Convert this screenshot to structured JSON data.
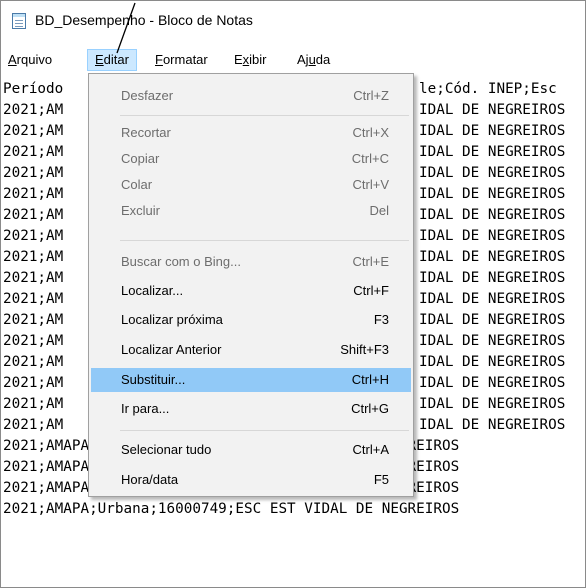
{
  "window": {
    "title": "BD_Desempenho - Bloco de Notas"
  },
  "menubar": {
    "items": [
      {
        "label": "Arquivo",
        "underline": "A",
        "rest": "rquivo"
      },
      {
        "label": "Editar",
        "underline": "E",
        "rest": "ditar"
      },
      {
        "label": "Formatar",
        "underline": "F",
        "rest": "ormatar"
      },
      {
        "label": "Exibir",
        "pre": "E",
        "underline": "x",
        "rest": "ibir"
      },
      {
        "label": "Ajuda",
        "pre": "Aj",
        "underline": "u",
        "rest": "da"
      }
    ],
    "active": "Editar"
  },
  "editor": {
    "lines": [
      "Período",
      "2021;AM",
      "2021;AM",
      "2021;AM",
      "2021;AM",
      "2021;AM",
      "2021;AM",
      "2021;AM",
      "2021;AM",
      "2021;AM",
      "2021;AM",
      "2021;AM",
      "2021;AM",
      "2021;AM",
      "2021;AM",
      "2021;AM",
      "2021;AM",
      "2021;AMAPA;Urbana;16000749;ESC EST VIDAL DE NEGREIROS",
      "2021;AMAPA;Urbana;16000749;ESC EST VIDAL DE NEGREIROS",
      "2021;AMAPA;Urbana;16000749;ESC EST VIDAL DE NEGREIROS",
      "2021;AMAPA;Urbana;16000749;ESC EST VIDAL DE NEGREIROS"
    ],
    "right_fragments": [
      "le;Cód. INEP;Esc",
      "IDAL DE NEGREIROS",
      "IDAL DE NEGREIROS",
      "IDAL DE NEGREIROS",
      "IDAL DE NEGREIROS",
      "IDAL DE NEGREIROS",
      "IDAL DE NEGREIROS",
      "IDAL DE NEGREIROS",
      "IDAL DE NEGREIROS",
      "IDAL DE NEGREIROS",
      "IDAL DE NEGREIROS",
      "IDAL DE NEGREIROS",
      "IDAL DE NEGREIROS",
      "IDAL DE NEGREIROS",
      "IDAL DE NEGREIROS",
      "IDAL DE NEGREIROS",
      "IDAL DE NEGREIROS"
    ]
  },
  "edit_menu": {
    "items": [
      {
        "label": "Desfazer",
        "shortcut": "Ctrl+Z",
        "enabled": false
      },
      {
        "label": "Recortar",
        "shortcut": "Ctrl+X",
        "enabled": false
      },
      {
        "label": "Copiar",
        "shortcut": "Ctrl+C",
        "enabled": false
      },
      {
        "label": "Colar",
        "shortcut": "Ctrl+V",
        "enabled": false
      },
      {
        "label": "Excluir",
        "shortcut": "Del",
        "enabled": false
      },
      {
        "label": "Buscar com o Bing...",
        "shortcut": "Ctrl+E",
        "enabled": false
      },
      {
        "label": "Localizar...",
        "shortcut": "Ctrl+F",
        "enabled": true
      },
      {
        "label": "Localizar próxima",
        "shortcut": "F3",
        "enabled": true
      },
      {
        "label": "Localizar Anterior",
        "shortcut": "Shift+F3",
        "enabled": true
      },
      {
        "label": "Substituir...",
        "shortcut": "Ctrl+H",
        "enabled": true
      },
      {
        "label": "Ir para...",
        "shortcut": "Ctrl+G",
        "enabled": true
      },
      {
        "label": "Selecionar tudo",
        "shortcut": "Ctrl+A",
        "enabled": true
      },
      {
        "label": "Hora/data",
        "shortcut": "F5",
        "enabled": true
      }
    ],
    "highlighted": "Substituir...",
    "colors": {
      "highlight": "#91c9f7",
      "menu_bg": "#f2f2f2",
      "disabled_text": "#6d6d6d"
    }
  }
}
